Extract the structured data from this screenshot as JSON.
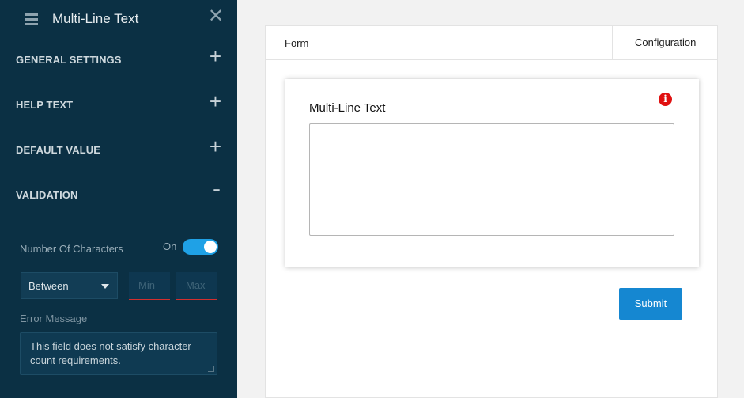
{
  "sidebar": {
    "title": "Multi-Line Text",
    "sections": [
      {
        "label": "GENERAL SETTINGS",
        "toggle": "+"
      },
      {
        "label": "HELP TEXT",
        "toggle": "+"
      },
      {
        "label": "DEFAULT VALUE",
        "toggle": "+"
      },
      {
        "label": "VALIDATION",
        "toggle": "-"
      }
    ],
    "validation": {
      "number_of_characters_label": "Number Of Characters",
      "toggle_state_label": "On",
      "toggle_on": true,
      "range_select_value": "Between",
      "min_placeholder": "Min",
      "max_placeholder": "Max",
      "error_message_label": "Error Message",
      "error_message_value": "This field does not satisfy character count requirements."
    }
  },
  "main": {
    "tabs": {
      "form": "Form",
      "configuration": "Configuration"
    },
    "field_label": "Multi-Line Text",
    "textarea_value": "",
    "submit_label": "Submit"
  },
  "colors": {
    "sidebar_bg": "#0b3044",
    "toggle_accent": "#1fa1e6",
    "submit_button": "#1587d1",
    "info_icon": "#e01010",
    "input_underline_error": "#d32f2f"
  },
  "icons": [
    "hamburger-icon",
    "close-icon",
    "plus-icon",
    "minus-icon",
    "caret-down-icon",
    "info-icon",
    "resize-handle-icon"
  ]
}
